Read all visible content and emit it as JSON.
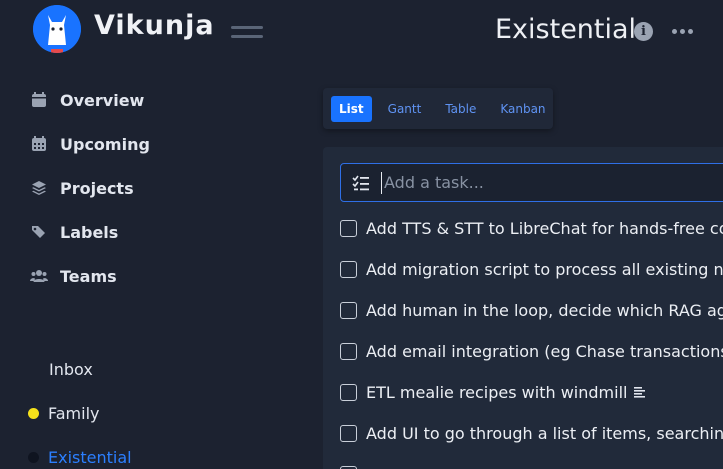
{
  "app": {
    "brand": "Vikunja",
    "accent_color": "#1973ff"
  },
  "header": {
    "project_title": "Existential",
    "info_icon": "i"
  },
  "sidebar": {
    "menu": [
      {
        "label": "Overview",
        "icon": "calendar-day-icon"
      },
      {
        "label": "Upcoming",
        "icon": "calendar-grid-icon"
      },
      {
        "label": "Projects",
        "icon": "layers-icon"
      },
      {
        "label": "Labels",
        "icon": "tags-icon"
      },
      {
        "label": "Teams",
        "icon": "users-icon"
      }
    ],
    "projects": [
      {
        "label": "Inbox",
        "color": ""
      },
      {
        "label": "Family",
        "color": "#f5e11b"
      },
      {
        "label": "Existential",
        "color": "#0f1420",
        "active": true
      }
    ]
  },
  "views": {
    "tabs": [
      {
        "label": "List",
        "active": true
      },
      {
        "label": "Gantt"
      },
      {
        "label": "Table"
      },
      {
        "label": "Kanban"
      }
    ]
  },
  "tasks": {
    "add_placeholder": "Add a task...",
    "items": [
      {
        "title": "Add TTS & STT to LibreChat for hands-free conve",
        "has_description": false
      },
      {
        "title": "Add migration script to process all existing note",
        "has_description": false
      },
      {
        "title": "Add human in the loop, decide which RAG agent",
        "has_description": false
      },
      {
        "title": "Add email integration (eg Chase transactions)",
        "has_description": false
      },
      {
        "title": "ETL mealie recipes with windmill",
        "has_description": true
      },
      {
        "title": "Add UI to go through a list of items, searching fo",
        "has_description": false
      }
    ]
  }
}
